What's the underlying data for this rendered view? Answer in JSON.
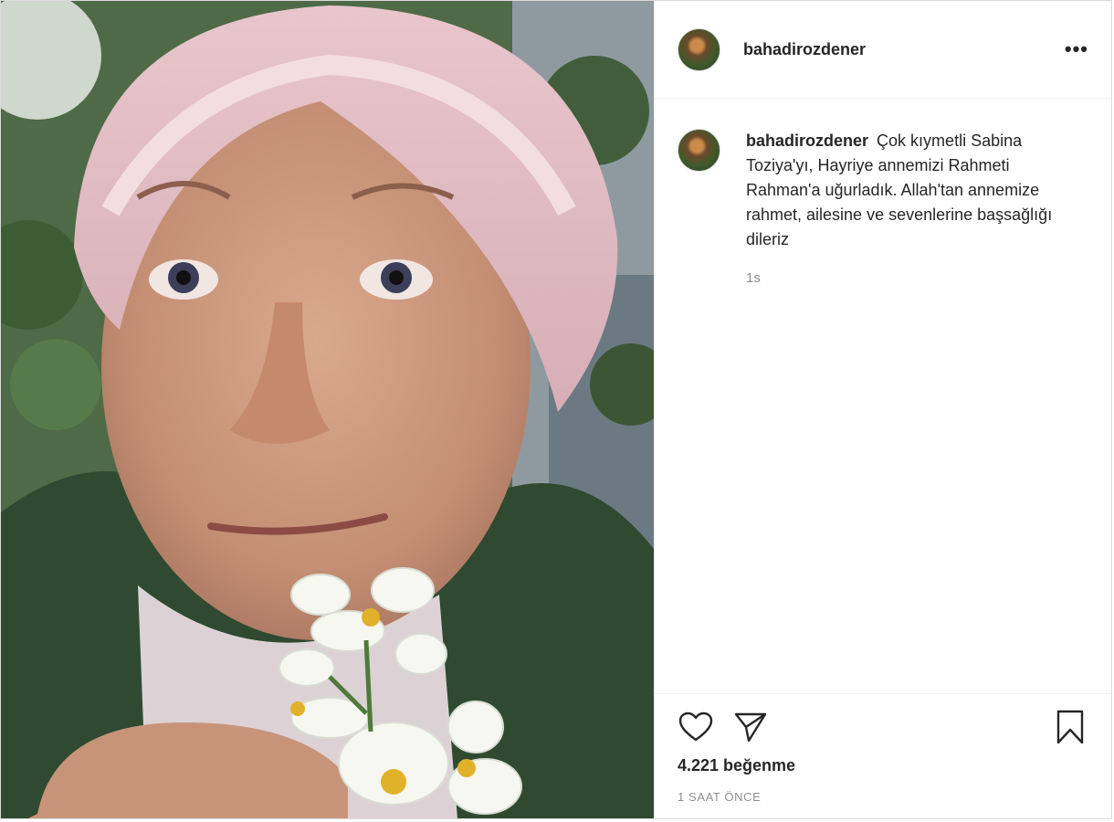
{
  "post": {
    "username": "bahadirozdener",
    "more_label": "•••",
    "caption": {
      "username": "bahadirozdener",
      "text": "Çok kıymetli Sabina Toziya'yı, Hayriye annemizi Rahmeti Rahman'a uğurladık. Allah'tan annemize rahmet, ailesine ve sevenlerine başsağlığı dileriz",
      "time": "1s"
    },
    "likes": "4.221 beğenme",
    "timestamp": "1 SAAT ÖNCE"
  },
  "icons": {
    "like": "heart-outline-icon",
    "share": "paper-plane-icon",
    "save": "bookmark-icon",
    "more": "ellipsis-icon"
  }
}
